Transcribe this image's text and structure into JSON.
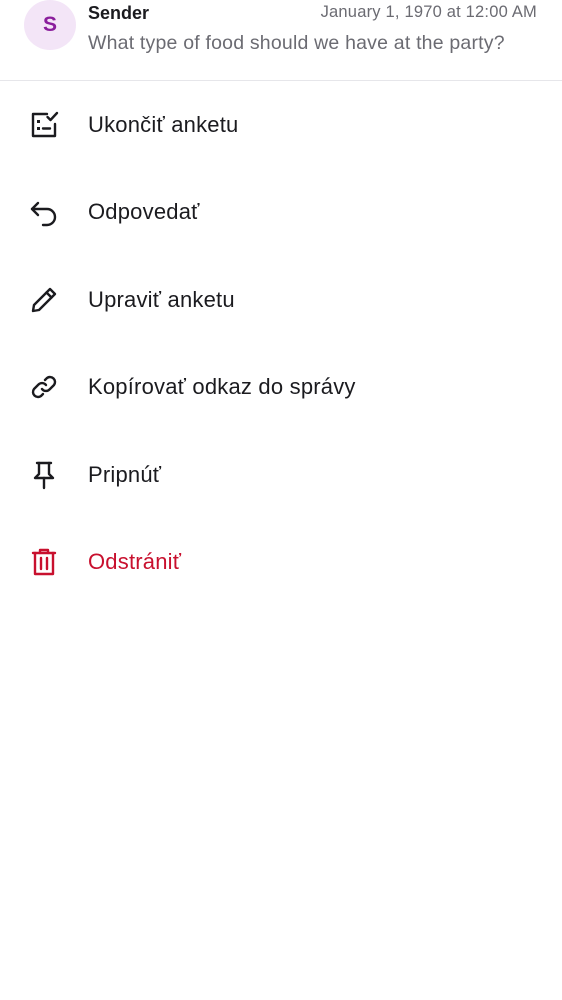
{
  "header": {
    "avatar_initial": "S",
    "sender": "Sender",
    "timestamp": "January 1, 1970 at 12:00 AM",
    "preview": "What type of food should we have at the party?"
  },
  "menu": {
    "items": [
      {
        "label": "Ukončiť anketu",
        "icon": "end-poll-icon"
      },
      {
        "label": "Odpovedať",
        "icon": "reply-icon"
      },
      {
        "label": "Upraviť anketu",
        "icon": "pencil-icon"
      },
      {
        "label": "Kopírovať odkaz do správy",
        "icon": "link-icon"
      },
      {
        "label": "Pripnúť",
        "icon": "pin-icon"
      },
      {
        "label": "Odstrániť",
        "icon": "trash-icon"
      }
    ]
  },
  "colors": {
    "text": "#1b1b1f",
    "muted": "#6b6b72",
    "danger": "#c8102e",
    "avatar_bg": "#f3e5f7",
    "avatar_fg": "#8a1e9c"
  }
}
